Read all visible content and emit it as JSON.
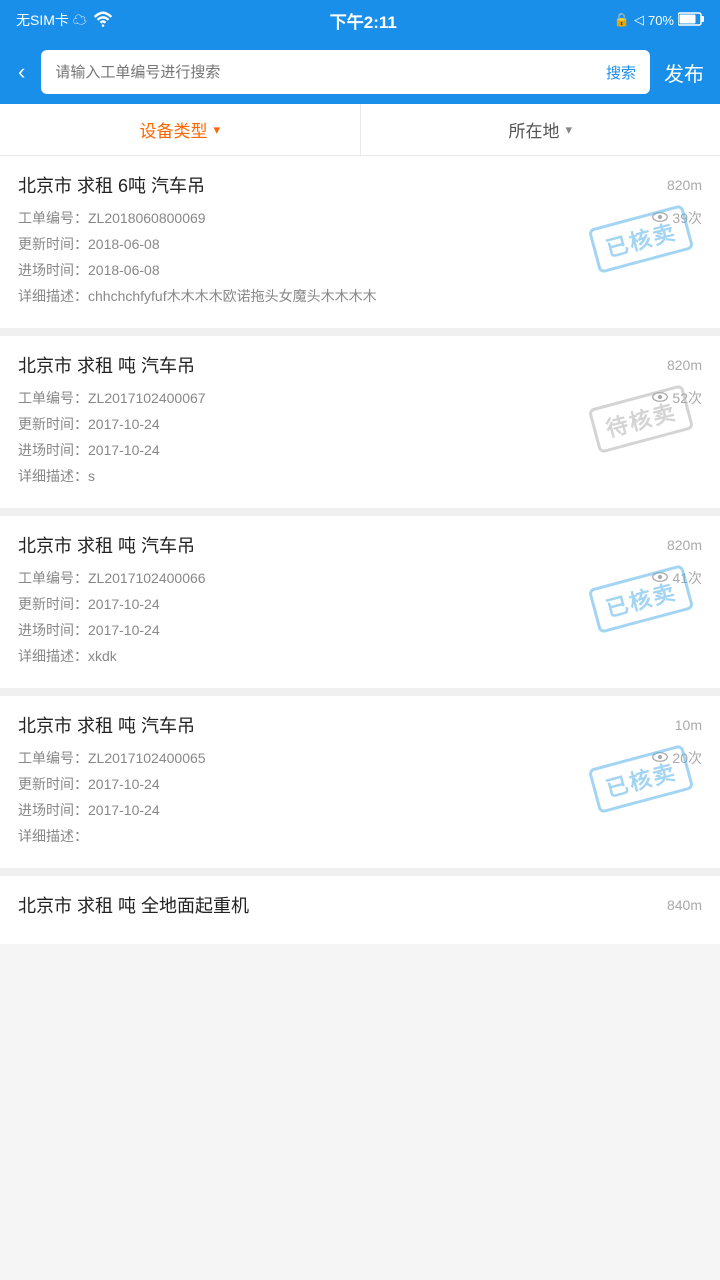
{
  "statusBar": {
    "left": "无SIM卡 ☁",
    "wifi": "📶",
    "time": "下午2:11",
    "lock": "🔒",
    "location": "◁",
    "battery": "70%"
  },
  "header": {
    "backLabel": "‹",
    "searchPlaceholder": "请输入工单编号进行搜索",
    "searchBtnLabel": "搜索",
    "publishLabel": "发布"
  },
  "filters": {
    "deviceType": {
      "label": "设备类型",
      "active": true
    },
    "location": {
      "label": "所在地",
      "active": false
    }
  },
  "items": [
    {
      "title": "北京市 求租 6吨 汽车吊",
      "distance": "820m",
      "workOrderNo": "工单编号：ZL2018060800069",
      "views": "39次",
      "updateTime": "更新时间：2018-06-08",
      "entryTime": "进场时间：2018-06-08",
      "description": "详细描述：chhchchfyfuf木木木木欧诺拖头女魔头木木木木",
      "stamp": "已核卖",
      "stampType": "sold"
    },
    {
      "title": "北京市 求租 吨 汽车吊",
      "distance": "820m",
      "workOrderNo": "工单编号：ZL2017102400067",
      "views": "52次",
      "updateTime": "更新时间：2017-10-24",
      "entryTime": "进场时间：2017-10-24",
      "description": "详细描述：s",
      "stamp": "待核卖",
      "stampType": "pending"
    },
    {
      "title": "北京市 求租 吨 汽车吊",
      "distance": "820m",
      "workOrderNo": "工单编号：ZL2017102400066",
      "views": "41次",
      "updateTime": "更新时间：2017-10-24",
      "entryTime": "进场时间：2017-10-24",
      "description": "详细描述：xkdk",
      "stamp": "已核卖",
      "stampType": "sold"
    },
    {
      "title": "北京市 求租 吨 汽车吊",
      "distance": "10m",
      "workOrderNo": "工单编号：ZL2017102400065",
      "views": "20次",
      "updateTime": "更新时间：2017-10-24",
      "entryTime": "进场时间：2017-10-24",
      "description": "详细描述：",
      "stamp": "已核卖",
      "stampType": "sold"
    },
    {
      "title": "北京市 求租 吨 全地面起重机",
      "distance": "840m",
      "workOrderNo": "",
      "views": "",
      "updateTime": "",
      "entryTime": "",
      "description": "",
      "stamp": "",
      "stampType": ""
    }
  ]
}
